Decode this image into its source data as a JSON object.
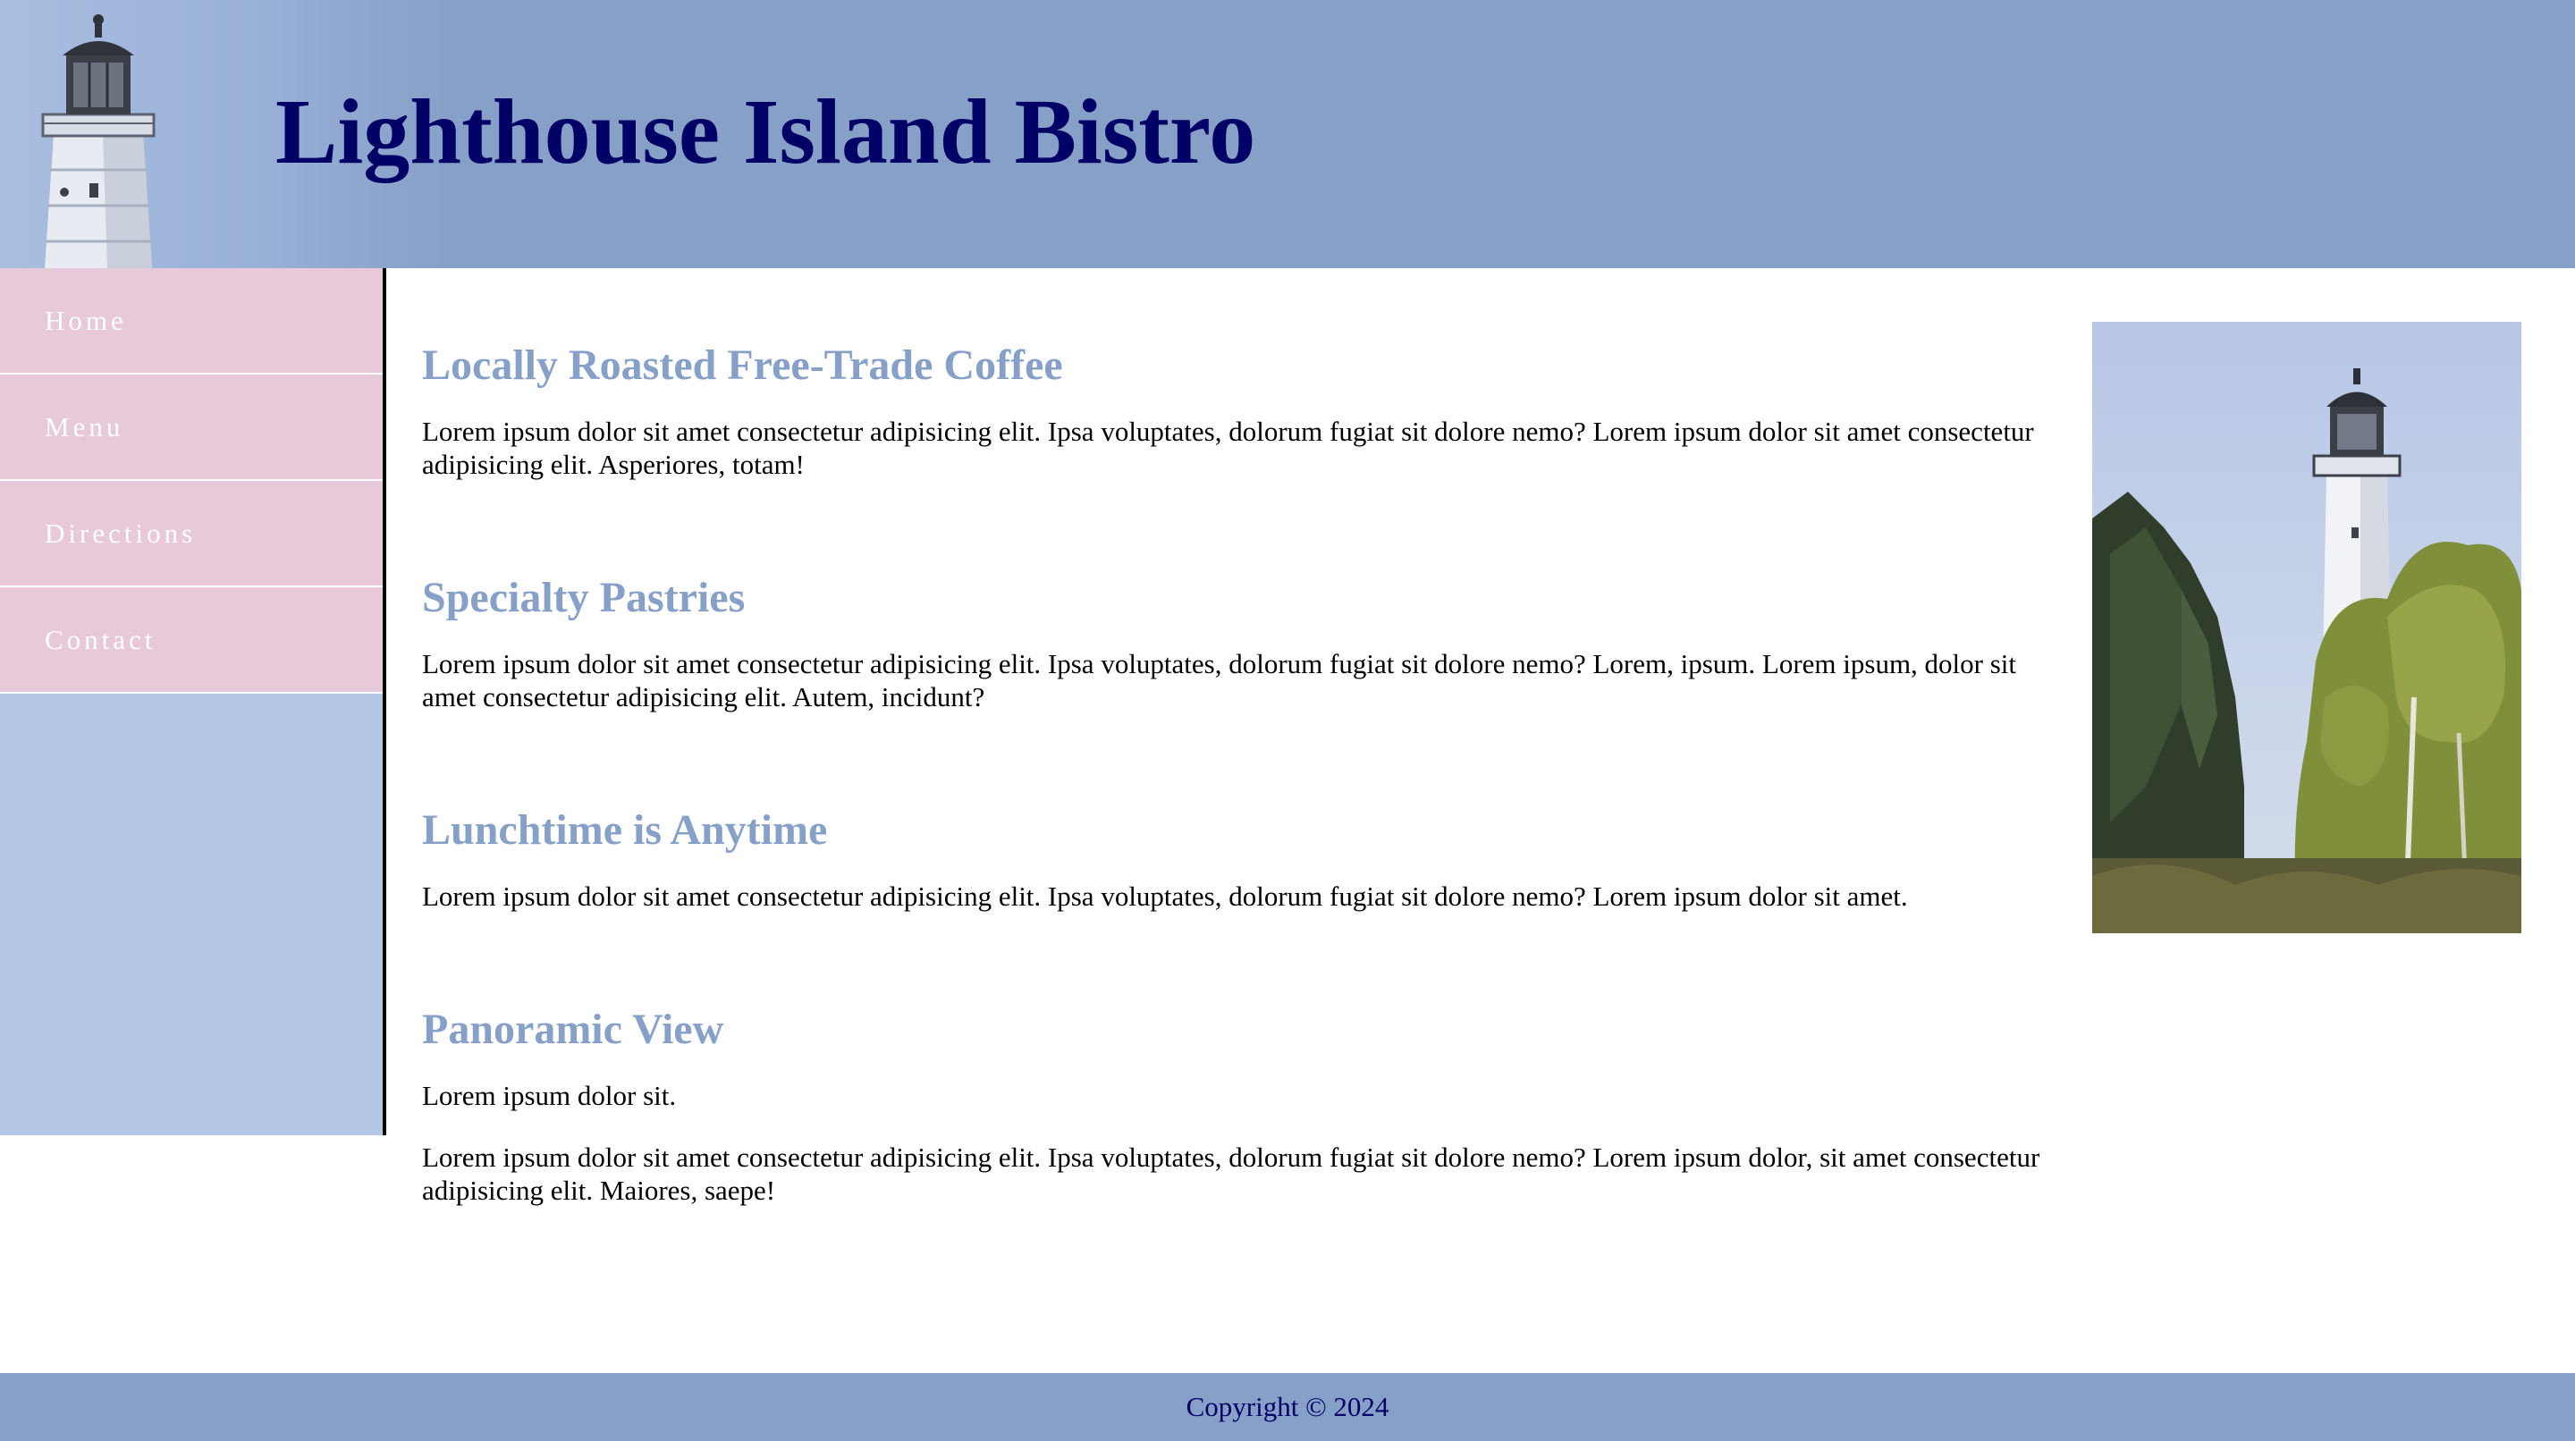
{
  "header": {
    "title": "Lighthouse Island Bistro"
  },
  "nav": {
    "items": [
      {
        "label": "Home"
      },
      {
        "label": "Menu"
      },
      {
        "label": "Directions"
      },
      {
        "label": "Contact"
      }
    ]
  },
  "main": {
    "sections": [
      {
        "heading": "Locally Roasted Free-Trade Coffee",
        "paragraphs": [
          "Lorem ipsum dolor sit amet consectetur adipisicing elit. Ipsa voluptates, dolorum fugiat sit dolore nemo? Lorem ipsum dolor sit amet consectetur adipisicing elit. Asperiores, totam!"
        ]
      },
      {
        "heading": "Specialty Pastries",
        "paragraphs": [
          "Lorem ipsum dolor sit amet consectetur adipisicing elit. Ipsa voluptates, dolorum fugiat sit dolore nemo? Lorem, ipsum. Lorem ipsum, dolor sit amet consectetur adipisicing elit. Autem, incidunt?"
        ]
      },
      {
        "heading": "Lunchtime is Anytime",
        "paragraphs": [
          "Lorem ipsum dolor sit amet consectetur adipisicing elit. Ipsa voluptates, dolorum fugiat sit dolore nemo? Lorem ipsum dolor sit amet."
        ]
      },
      {
        "heading": "Panoramic View",
        "paragraphs": [
          "Lorem ipsum dolor sit.",
          "Lorem ipsum dolor sit amet consectetur adipisicing elit. Ipsa voluptates, dolorum fugiat sit dolore nemo? Lorem ipsum dolor, sit amet consectetur adipisicing elit. Maiores, saepe!"
        ]
      }
    ]
  },
  "footer": {
    "copyright": "Copyright © 2024"
  },
  "colors": {
    "header_bg": "#87a0c8",
    "title": "#000066",
    "nav_item_bg": "#e8c9da",
    "sidebar_bg": "#b3c6e6",
    "heading": "#87a0c8"
  }
}
